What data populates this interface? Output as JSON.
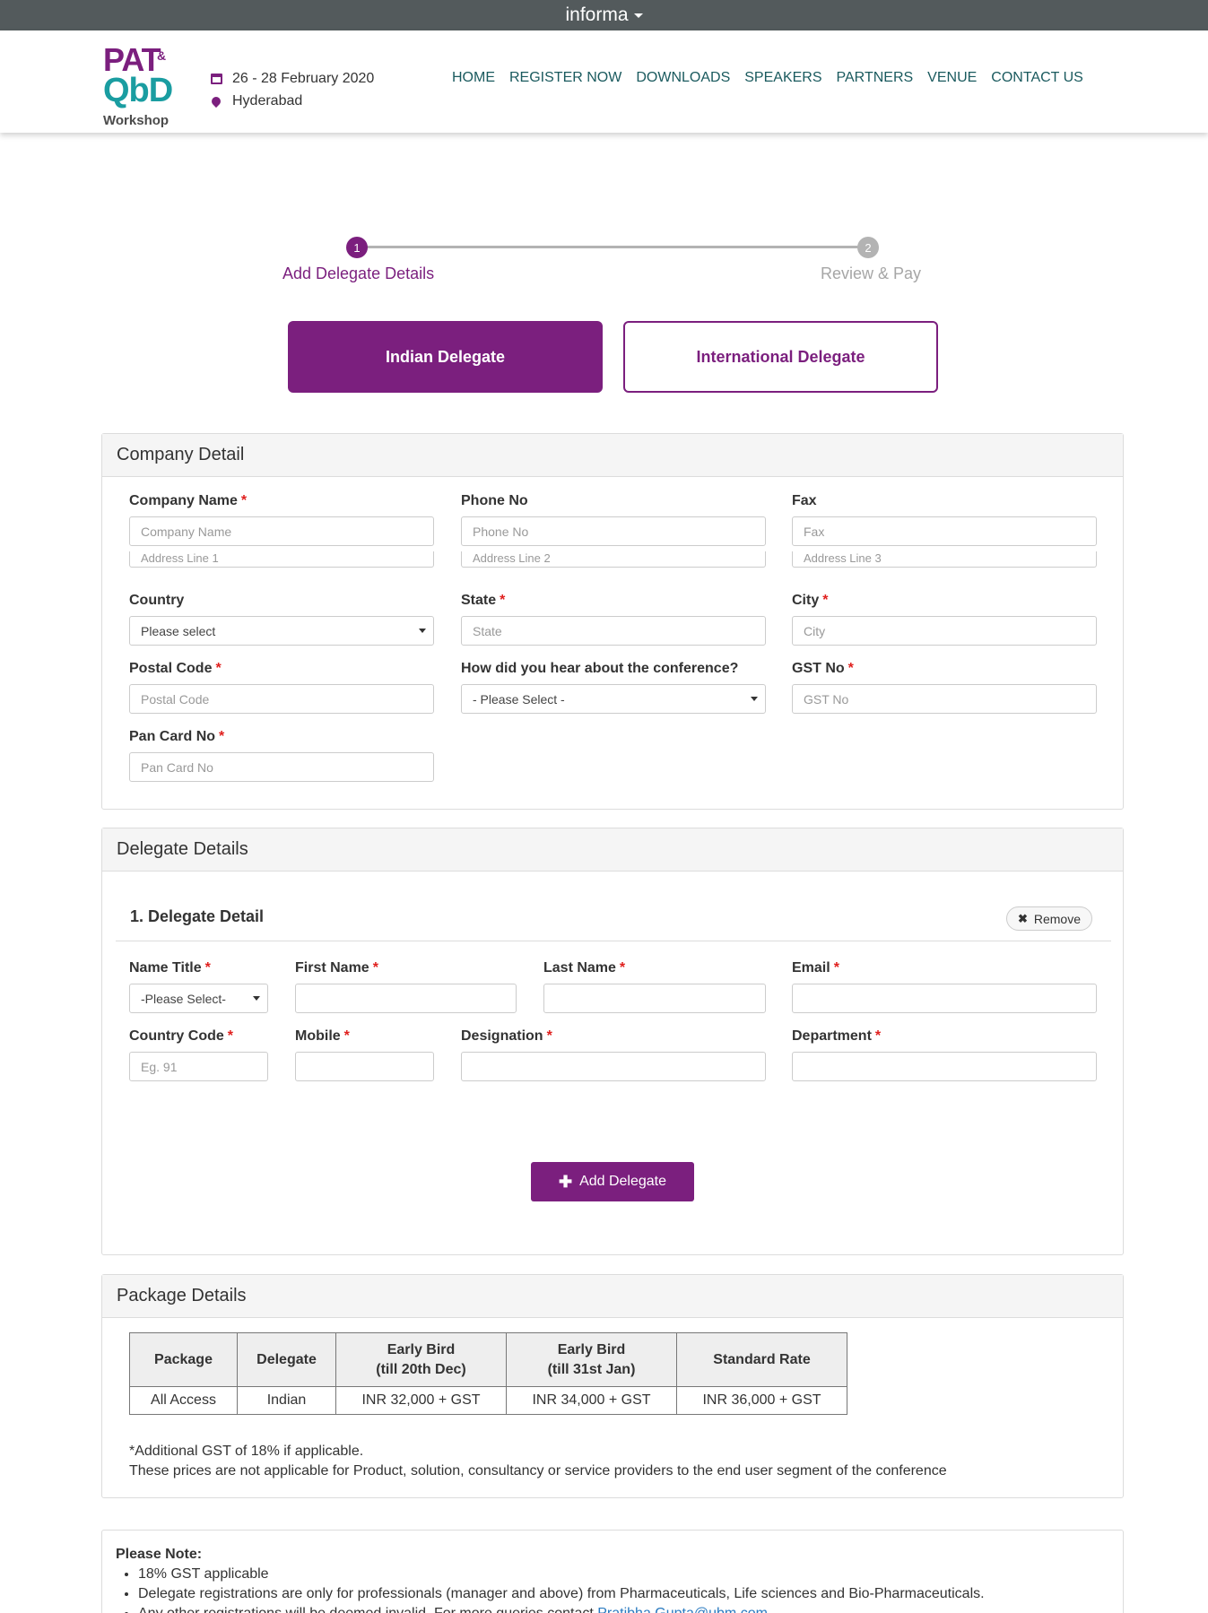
{
  "topbar": {
    "brand": "informa"
  },
  "header": {
    "logo": {
      "line1": "PAT",
      "amp": "&",
      "line2": "QbD",
      "line3": "Workshop"
    },
    "date": "26 - 28 February 2020",
    "location": "Hyderabad",
    "nav": [
      "HOME",
      "REGISTER NOW",
      "DOWNLOADS",
      "SPEAKERS",
      "PARTNERS",
      "VENUE",
      "CONTACT US"
    ]
  },
  "steps": [
    {
      "num": "1",
      "label": "Add Delegate Details"
    },
    {
      "num": "2",
      "label": "Review & Pay"
    }
  ],
  "delegate_type": {
    "indian": "Indian Delegate",
    "international": "International Delegate"
  },
  "company": {
    "title": "Company Detail",
    "company_name_label": "Company Name",
    "company_name_placeholder": "Company Name",
    "phone_label": "Phone No",
    "phone_placeholder": "Phone No",
    "fax_label": "Fax",
    "fax_placeholder": "Fax",
    "address1_placeholder": "Address Line 1",
    "address2_placeholder": "Address Line 2",
    "address3_placeholder": "Address Line 3",
    "country_label": "Country",
    "country_value": "Please select",
    "state_label": "State",
    "state_placeholder": "State",
    "city_label": "City",
    "city_placeholder": "City",
    "postal_label": "Postal Code",
    "postal_placeholder": "Postal Code",
    "hear_label": "How did you hear about the conference?",
    "hear_value": "- Please Select -",
    "gst_label": "GST No",
    "gst_placeholder": "GST No",
    "pan_label": "Pan Card No",
    "pan_placeholder": "Pan Card No",
    "required_mark": "*"
  },
  "delegates": {
    "title": "Delegate Details",
    "item_title": "1.  Delegate Detail",
    "remove_label": "Remove",
    "name_title_label": "Name Title",
    "name_title_value": "-Please Select-",
    "first_name_label": "First Name",
    "last_name_label": "Last Name",
    "email_label": "Email",
    "country_code_label": "Country Code",
    "country_code_placeholder": "Eg. 91",
    "mobile_label": "Mobile",
    "designation_label": "Designation",
    "department_label": "Department",
    "add_label": "Add Delegate"
  },
  "package": {
    "title": "Package Details",
    "headers": [
      {
        "line1": "Package",
        "line2": ""
      },
      {
        "line1": "Delegate",
        "line2": ""
      },
      {
        "line1": "Early Bird",
        "line2": "(till 20th Dec)"
      },
      {
        "line1": "Early Bird",
        "line2": "(till 31st Jan)"
      },
      {
        "line1": "Standard Rate",
        "line2": ""
      }
    ],
    "rows": [
      [
        "All Access",
        "Indian",
        "INR 32,000 + GST",
        "INR 34,000 + GST",
        "INR 36,000 + GST"
      ]
    ],
    "note1": "*Additional GST of 18% if applicable.",
    "note2": "These prices are not applicable for Product, solution, consultancy or service providers to the end user segment of the conference"
  },
  "notes": {
    "title": "Please Note:",
    "items": [
      "18% GST applicable",
      "Delegate registrations are only for professionals (manager and above) from Pharmaceuticals, Life sciences and Bio-Pharmaceuticals.",
      "Any other registrations will be deemed invalid. For more queries contact "
    ],
    "contact": "Pratibha.Gupta@ubm.com"
  }
}
